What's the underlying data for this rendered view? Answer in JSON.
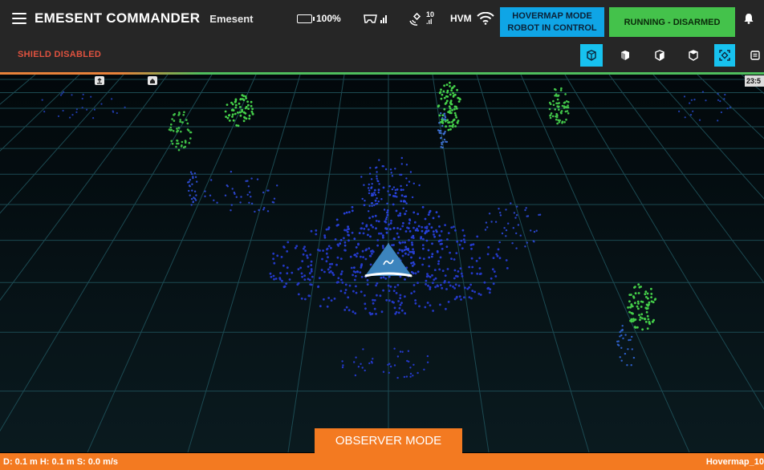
{
  "header": {
    "app_title": "EMESENT COMMANDER",
    "app_subtitle": "Emesent",
    "battery": "100%",
    "gps_count": "10",
    "hvm_label": "HVM",
    "mode_line1": "HOVERMAP MODE",
    "mode_line2": "ROBOT IN CONTROL",
    "running_status": "RUNNING - DISARMED"
  },
  "toolbar": {
    "shield_status": "SHIELD DISABLED",
    "view_buttons": [
      "perspective-view",
      "front-view",
      "side-view",
      "back-view",
      "fit-view",
      "message"
    ],
    "active_view": "perspective-view"
  },
  "viewport": {
    "time": "23:5"
  },
  "observer_label": "OBSERVER MODE",
  "footer": {
    "dhs": "D: 0.1 m  H: 0.1 m  S: 0.0 m/s",
    "device": "Hovermap_10"
  },
  "colors": {
    "accent_orange": "#f37a21",
    "mode_blue": "#0fa5e6",
    "running_green": "#44c24b",
    "shield_red": "#e0523f",
    "active_button": "#17c2ef"
  }
}
